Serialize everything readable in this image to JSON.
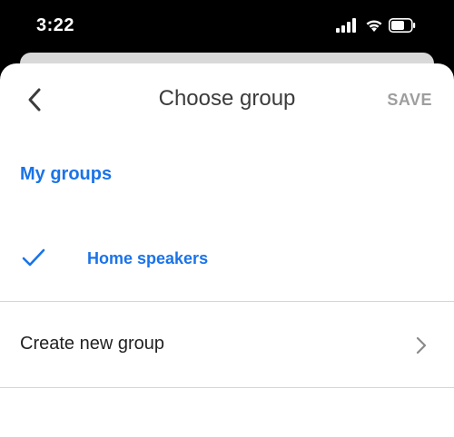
{
  "status_bar": {
    "time": "3:22",
    "icons": [
      "signal-icon",
      "wifi-icon",
      "battery-icon"
    ]
  },
  "header": {
    "back_icon": "chevron-left-icon",
    "title": "Choose group",
    "save_label": "SAVE"
  },
  "groups": {
    "heading": "My groups",
    "items": [
      {
        "label": "Home speakers",
        "selected": true,
        "icon": "check-icon"
      }
    ]
  },
  "actions": {
    "create_label": "Create new group",
    "create_icon": "chevron-right-icon"
  },
  "colors": {
    "accent": "#1a73e8",
    "save_disabled": "#9e9e9e",
    "divider": "#d6d6d6",
    "text": "#222222"
  }
}
